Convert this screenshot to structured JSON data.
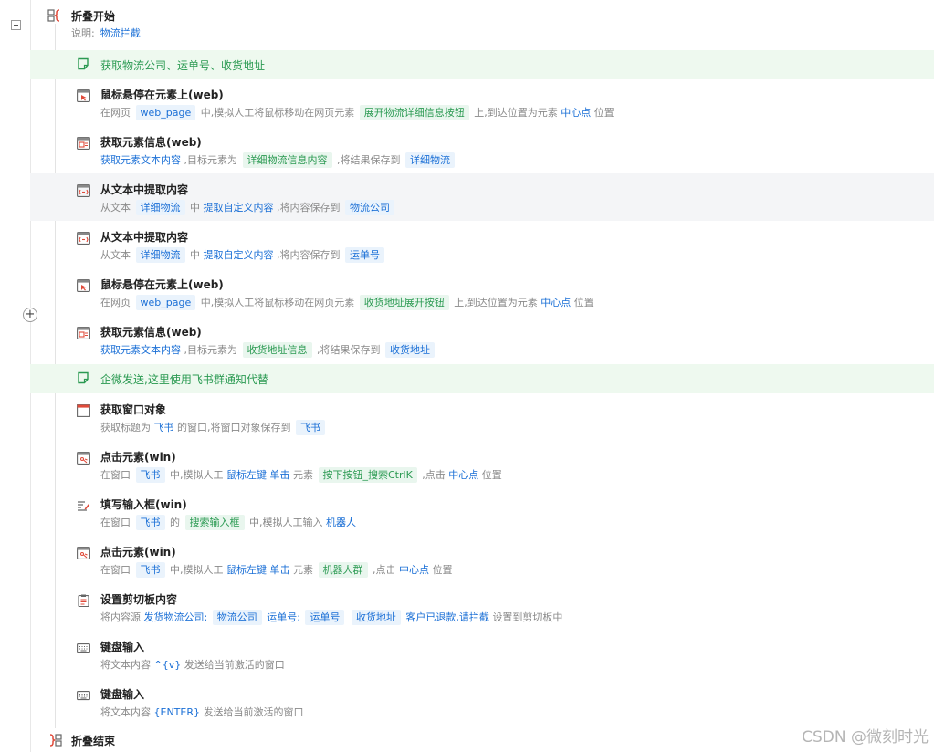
{
  "fold_start": {
    "title": "折叠开始",
    "desc_label": "说明:",
    "desc_value": "物流拦截"
  },
  "comments": [
    {
      "text": "获取物流公司、运单号、收货地址"
    },
    {
      "text": "企微发送,这里使用飞书群通知代替"
    }
  ],
  "steps": [
    {
      "icon": "browser-hover-icon",
      "title": "鼠标悬停在元素上(web)",
      "desc": [
        {
          "t": "text",
          "v": "在网页"
        },
        {
          "t": "chip",
          "v": "web_page"
        },
        {
          "t": "text",
          "v": "中,模拟人工将鼠标移动在网页元素"
        },
        {
          "t": "chipg",
          "v": "展开物流详细信息按钮"
        },
        {
          "t": "text",
          "v": "上,到达位置为元素"
        },
        {
          "t": "kw",
          "v": "中心点"
        },
        {
          "t": "text",
          "v": "位置"
        }
      ]
    },
    {
      "icon": "browser-info-icon",
      "title": "获取元素信息(web)",
      "desc": [
        {
          "t": "kw",
          "v": "获取元素文本内容"
        },
        {
          "t": "text",
          "v": ",目标元素为"
        },
        {
          "t": "chipg",
          "v": "详细物流信息内容"
        },
        {
          "t": "text",
          "v": ",将结果保存到"
        },
        {
          "t": "chip",
          "v": "详细物流"
        }
      ]
    },
    {
      "icon": "text-extract-icon",
      "title": "从文本中提取内容",
      "desc": [
        {
          "t": "text",
          "v": "从文本"
        },
        {
          "t": "chip",
          "v": "详细物流"
        },
        {
          "t": "text",
          "v": "中"
        },
        {
          "t": "kw",
          "v": "提取自定义内容"
        },
        {
          "t": "text",
          "v": ",将内容保存到"
        },
        {
          "t": "chip",
          "v": "物流公司"
        }
      ]
    },
    {
      "icon": "text-extract-icon",
      "title": "从文本中提取内容",
      "desc": [
        {
          "t": "text",
          "v": "从文本"
        },
        {
          "t": "chip",
          "v": "详细物流"
        },
        {
          "t": "text",
          "v": "中"
        },
        {
          "t": "kw",
          "v": "提取自定义内容"
        },
        {
          "t": "text",
          "v": ",将内容保存到"
        },
        {
          "t": "chip",
          "v": "运单号"
        }
      ]
    },
    {
      "icon": "browser-hover-icon",
      "title": "鼠标悬停在元素上(web)",
      "desc": [
        {
          "t": "text",
          "v": "在网页"
        },
        {
          "t": "chip",
          "v": "web_page"
        },
        {
          "t": "text",
          "v": "中,模拟人工将鼠标移动在网页元素"
        },
        {
          "t": "chipg",
          "v": "收货地址展开按钮"
        },
        {
          "t": "text",
          "v": "上,到达位置为元素"
        },
        {
          "t": "kw",
          "v": "中心点"
        },
        {
          "t": "text",
          "v": "位置"
        }
      ]
    },
    {
      "icon": "browser-info-icon",
      "title": "获取元素信息(web)",
      "desc": [
        {
          "t": "kw",
          "v": "获取元素文本内容"
        },
        {
          "t": "text",
          "v": ",目标元素为"
        },
        {
          "t": "chipg",
          "v": "收货地址信息"
        },
        {
          "t": "text",
          "v": ",将结果保存到"
        },
        {
          "t": "chip",
          "v": "收货地址"
        }
      ]
    },
    {
      "icon": "window-icon",
      "title": "获取窗口对象",
      "desc": [
        {
          "t": "text",
          "v": "获取标题为"
        },
        {
          "t": "kw",
          "v": "飞书"
        },
        {
          "t": "text",
          "v": "的窗口,将窗口对象保存到"
        },
        {
          "t": "chip",
          "v": "飞书"
        }
      ]
    },
    {
      "icon": "click-element-icon",
      "title": "点击元素(win)",
      "desc": [
        {
          "t": "text",
          "v": "在窗口"
        },
        {
          "t": "chip",
          "v": "飞书"
        },
        {
          "t": "text",
          "v": "中,模拟人工"
        },
        {
          "t": "kw",
          "v": "鼠标左键"
        },
        {
          "t": "kw",
          "v": "单击"
        },
        {
          "t": "text",
          "v": "元素"
        },
        {
          "t": "chipg",
          "v": "按下按钮_搜索CtrlK"
        },
        {
          "t": "text",
          "v": ",点击"
        },
        {
          "t": "kw",
          "v": "中心点"
        },
        {
          "t": "text",
          "v": "位置"
        }
      ]
    },
    {
      "icon": "input-field-icon",
      "title": "填写输入框(win)",
      "desc": [
        {
          "t": "text",
          "v": "在窗口"
        },
        {
          "t": "chip",
          "v": "飞书"
        },
        {
          "t": "text",
          "v": "的"
        },
        {
          "t": "chipg",
          "v": "搜索输入框"
        },
        {
          "t": "text",
          "v": "中,模拟人工输入"
        },
        {
          "t": "kw",
          "v": "机器人"
        }
      ]
    },
    {
      "icon": "click-element-icon",
      "title": "点击元素(win)",
      "desc": [
        {
          "t": "text",
          "v": "在窗口"
        },
        {
          "t": "chip",
          "v": "飞书"
        },
        {
          "t": "text",
          "v": "中,模拟人工"
        },
        {
          "t": "kw",
          "v": "鼠标左键"
        },
        {
          "t": "kw",
          "v": "单击"
        },
        {
          "t": "text",
          "v": "元素"
        },
        {
          "t": "chipg",
          "v": "机器人群"
        },
        {
          "t": "text",
          "v": ",点击"
        },
        {
          "t": "kw",
          "v": "中心点"
        },
        {
          "t": "text",
          "v": "位置"
        }
      ]
    },
    {
      "icon": "clipboard-icon",
      "title": "设置剪切板内容",
      "desc": [
        {
          "t": "text",
          "v": "将内容源"
        },
        {
          "t": "kw",
          "v": "发货物流公司:"
        },
        {
          "t": "chip",
          "v": "物流公司"
        },
        {
          "t": "kw",
          "v": "运单号:"
        },
        {
          "t": "chip",
          "v": "运单号"
        },
        {
          "t": "chip",
          "v": "收货地址"
        },
        {
          "t": "kw",
          "v": "客户已退款,请拦截"
        },
        {
          "t": "text",
          "v": "设置到剪切板中"
        }
      ]
    },
    {
      "icon": "keyboard-icon",
      "title": "键盘输入",
      "desc": [
        {
          "t": "text",
          "v": "将文本内容"
        },
        {
          "t": "kw",
          "v": "^{v}"
        },
        {
          "t": "text",
          "v": "发送给当前激活的窗口"
        }
      ]
    },
    {
      "icon": "keyboard-icon",
      "title": "键盘输入",
      "desc": [
        {
          "t": "text",
          "v": "将文本内容"
        },
        {
          "t": "kw",
          "v": "{ENTER}"
        },
        {
          "t": "text",
          "v": "发送给当前激活的窗口"
        }
      ]
    }
  ],
  "fold_end": {
    "title": "折叠结束"
  },
  "watermark": "CSDN @微刻时光",
  "colors": {
    "keyword": "#1a6fd6",
    "element_chip": "#2b9a52",
    "comment_band": "#eef9ef",
    "hover_band": "#f4f5f7"
  }
}
